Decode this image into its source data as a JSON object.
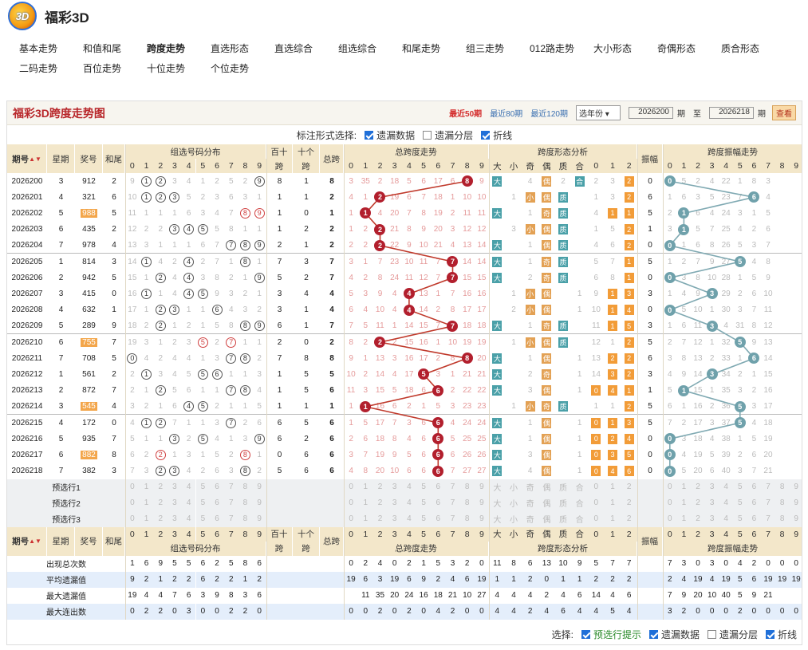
{
  "app": {
    "title": "福彩3D",
    "logo": "3D"
  },
  "nav": [
    [
      "基本走势",
      "和值和尾",
      "跨度走势",
      "直选形态",
      "直选综合",
      "组选综合",
      "和尾走势",
      "组三走势",
      "012路走势",
      "大小形态",
      "奇偶形态",
      "质合形态"
    ],
    [
      "二码走势",
      "百位走势",
      "十位走势",
      "个位走势"
    ]
  ],
  "nav_active": "跨度走势",
  "panel": {
    "title": "福彩3D跨度走势图",
    "quick": [
      "最近50期",
      "最近80期",
      "最近120期"
    ],
    "year_select": "选年份",
    "from": "2026200",
    "to": "2026218",
    "qi": "期",
    "zhi": "至",
    "btn": "查看"
  },
  "marking": {
    "label": "标注形式选择:",
    "opts": [
      "遗漏数据",
      "遗漏分层",
      "折线"
    ],
    "checked": [
      true,
      false,
      true
    ]
  },
  "headers": {
    "qihao": "期号",
    "week": "星期",
    "jianghao": "奖号",
    "hewei": "和尾",
    "zuxuan": "组选号码分布",
    "baishi": "百十",
    "baishi2": "跨",
    "shige": "十个",
    "shige2": "跨",
    "zongkua": "总跨",
    "zkt": "总跨度走势",
    "xt": "跨度形态分析",
    "zhenfu": "振幅",
    "zfzs": "跨度振幅走势",
    "xtcols": [
      "大",
      "小",
      "奇",
      "偶",
      "质",
      "合",
      "0",
      "1",
      "2"
    ]
  },
  "rows": [
    [
      "2026200",
      "3",
      "912",
      "2",
      [
        9,
        1,
        2,
        3,
        4,
        1,
        2,
        5,
        2,
        9
      ],
      [
        1,
        2,
        9
      ],
      "8",
      "1",
      "8",
      [
        3,
        35,
        2,
        18,
        5,
        6,
        17,
        6,
        8,
        9
      ],
      8,
      [
        "大",
        "",
        4,
        "偶",
        2,
        "合",
        2,
        3,
        "2"
      ],
      [
        0,
        2
      ],
      "0",
      [
        0,
        5,
        2,
        4,
        22,
        1,
        8,
        3,
        "",
        ""
      ],
      0
    ],
    [
      "2026201",
      "4",
      "321",
      "6",
      [
        10,
        1,
        2,
        3,
        5,
        2,
        3,
        6,
        3,
        1
      ],
      [
        1,
        2,
        3
      ],
      "1",
      "1",
      "2",
      [
        4,
        1,
        2,
        19,
        6,
        7,
        18,
        1,
        10,
        10
      ],
      2,
      [
        "",
        1,
        "小",
        "偶",
        "质",
        "",
        1,
        3,
        "2"
      ],
      [
        0,
        2
      ],
      "6",
      [
        1,
        6,
        3,
        5,
        23,
        7,
        6,
        4,
        "",
        ""
      ],
      6
    ],
    [
      "2026202",
      "5",
      "988",
      "5",
      [
        11,
        1,
        1,
        1,
        6,
        3,
        4,
        7,
        8,
        9
      ],
      [
        8,
        9
      ],
      "1",
      "0",
      "1",
      [
        1,
        1,
        4,
        20,
        7,
        8,
        19,
        2,
        11,
        11
      ],
      1,
      [
        "大",
        "",
        1,
        "奇",
        "质",
        "",
        4,
        "1",
        "1"
      ],
      [
        1
      ],
      "5",
      [
        2,
        1,
        6,
        4,
        24,
        3,
        1,
        5,
        "",
        ""
      ],
      1
    ],
    [
      "2026203",
      "6",
      "435",
      "2",
      [
        12,
        2,
        2,
        3,
        4,
        5,
        5,
        8,
        1,
        1
      ],
      [
        3,
        4,
        5
      ],
      "1",
      "2",
      "2",
      [
        1,
        2,
        5,
        21,
        8,
        9,
        20,
        3,
        12,
        12
      ],
      2,
      [
        "",
        3,
        "小",
        "偶",
        "质",
        "",
        1,
        5,
        "2"
      ],
      [
        3,
        5
      ],
      "1",
      [
        3,
        1,
        5,
        7,
        25,
        4,
        2,
        6,
        "",
        ""
      ],
      1
    ],
    [
      "2026204",
      "7",
      "978",
      "4",
      [
        13,
        3,
        1,
        1,
        1,
        6,
        7,
        8,
        9,
        2
      ],
      [
        7,
        8,
        9
      ],
      "2",
      "1",
      "2",
      [
        2,
        2,
        6,
        22,
        9,
        10,
        21,
        4,
        13,
        14
      ],
      2,
      [
        "大",
        "",
        1,
        "偶",
        "质",
        "",
        4,
        6,
        "2"
      ],
      [
        3,
        5
      ],
      "0",
      [
        0,
        1,
        6,
        8,
        26,
        5,
        3,
        7,
        "",
        ""
      ],
      0
    ],
    [
      "2026205",
      "1",
      "814",
      "3",
      [
        14,
        1,
        4,
        2,
        4,
        2,
        7,
        1,
        8,
        1
      ],
      [
        1,
        4,
        8
      ],
      "7",
      "3",
      "7",
      [
        3,
        1,
        7,
        23,
        10,
        11,
        7,
        1,
        14,
        14
      ],
      7,
      [
        "大",
        "",
        1,
        "奇",
        "质",
        "",
        5,
        7,
        "1"
      ],
      [
        6
      ],
      "5",
      [
        1,
        2,
        7,
        9,
        27,
        5,
        4,
        8,
        "",
        ""
      ],
      5
    ],
    [
      "2026206",
      "2",
      "942",
      "5",
      [
        15,
        1,
        2,
        4,
        4,
        3,
        8,
        2,
        1,
        9
      ],
      [
        2,
        4,
        9
      ],
      "5",
      "2",
      "7",
      [
        4,
        2,
        8,
        24,
        11,
        12,
        7,
        6,
        15,
        15
      ],
      7,
      [
        "大",
        "",
        2,
        "奇",
        "质",
        "",
        6,
        8,
        "1"
      ],
      [
        6
      ],
      "0",
      [
        0,
        3,
        8,
        10,
        28,
        1,
        5,
        9,
        "",
        ""
      ],
      0
    ],
    [
      "2026207",
      "3",
      "415",
      "0",
      [
        16,
        1,
        1,
        4,
        4,
        5,
        9,
        3,
        2,
        1
      ],
      [
        1,
        4,
        5
      ],
      "3",
      "4",
      "4",
      [
        5,
        3,
        9,
        4,
        12,
        13,
        1,
        7,
        16,
        16
      ],
      4,
      [
        "",
        1,
        "小",
        "偶",
        "",
        1,
        9,
        "1",
        "3"
      ],
      [
        7
      ],
      "3",
      [
        1,
        4,
        9,
        3,
        29,
        2,
        6,
        10,
        "",
        ""
      ],
      3
    ],
    [
      "2026208",
      "4",
      "632",
      "1",
      [
        17,
        1,
        2,
        3,
        1,
        1,
        6,
        4,
        3,
        2
      ],
      [
        2,
        3,
        6
      ],
      "3",
      "1",
      "4",
      [
        6,
        4,
        10,
        4,
        13,
        14,
        2,
        8,
        17,
        17
      ],
      4,
      [
        "",
        2,
        "小",
        "偶",
        "",
        1,
        10,
        "1",
        "4"
      ],
      [
        7
      ],
      "0",
      [
        0,
        5,
        10,
        1,
        30,
        3,
        7,
        11,
        "",
        ""
      ],
      0
    ],
    [
      "2026209",
      "5",
      "289",
      "9",
      [
        18,
        2,
        2,
        1,
        2,
        1,
        5,
        8,
        9,
        1
      ],
      [
        2,
        8,
        9
      ],
      "6",
      "1",
      "7",
      [
        7,
        5,
        11,
        1,
        14,
        15,
        7,
        9,
        18,
        18
      ],
      7,
      [
        "大",
        "",
        1,
        "奇",
        "质",
        "",
        11,
        "1",
        "5"
      ],
      [
        6
      ],
      "3",
      [
        1,
        6,
        11,
        3,
        4,
        31,
        8,
        12,
        "",
        ""
      ],
      3
    ],
    [
      "2026210",
      "6",
      "755",
      "7",
      [
        19,
        3,
        1,
        2,
        3,
        5,
        2,
        7,
        1,
        1
      ],
      [
        5,
        7
      ],
      "2",
      "0",
      "2",
      [
        8,
        2,
        1,
        2,
        15,
        16,
        1,
        10,
        19,
        19
      ],
      2,
      [
        "",
        1,
        "小",
        "偶",
        "质",
        "",
        12,
        1,
        "2"
      ],
      [
        0,
        2
      ],
      "5",
      [
        2,
        7,
        12,
        1,
        32,
        5,
        9,
        13,
        "",
        ""
      ],
      5
    ],
    [
      "2026211",
      "7",
      "708",
      "5",
      [
        0,
        4,
        2,
        4,
        4,
        1,
        3,
        7,
        8,
        2
      ],
      [
        0,
        7,
        8
      ],
      "7",
      "8",
      "8",
      [
        9,
        1,
        13,
        3,
        16,
        17,
        2,
        8,
        20,
        20
      ],
      8,
      [
        "大",
        "",
        1,
        "偶",
        "",
        1,
        13,
        "2",
        "2"
      ],
      [
        2
      ],
      "6",
      [
        3,
        8,
        13,
        2,
        33,
        1,
        6,
        14,
        "",
        ""
      ],
      6
    ],
    [
      "2026212",
      "1",
      "561",
      "2",
      [
        2,
        1,
        3,
        4,
        5,
        5,
        6,
        1,
        1,
        3
      ],
      [
        1,
        5,
        6
      ],
      "1",
      "5",
      "5",
      [
        10,
        2,
        14,
        4,
        17,
        5,
        3,
        1,
        21,
        21
      ],
      5,
      [
        "大",
        "",
        2,
        "奇",
        "",
        1,
        14,
        "3",
        "2"
      ],
      [
        5
      ],
      "3",
      [
        4,
        9,
        14,
        3,
        34,
        2,
        1,
        15,
        "",
        ""
      ],
      3
    ],
    [
      "2026213",
      "2",
      "872",
      "7",
      [
        2,
        1,
        2,
        5,
        6,
        1,
        1,
        7,
        8,
        4
      ],
      [
        2,
        7,
        8
      ],
      "1",
      "5",
      "6",
      [
        11,
        3,
        15,
        5,
        18,
        6,
        4,
        2,
        22,
        22
      ],
      6,
      [
        "大",
        "",
        3,
        "偶",
        "",
        1,
        "0",
        "4",
        "1"
      ],
      [
        6
      ],
      "1",
      [
        5,
        1,
        15,
        1,
        35,
        3,
        2,
        16,
        "",
        ""
      ],
      1
    ],
    [
      "2026214",
      "3",
      "545",
      "4",
      [
        3,
        2,
        1,
        6,
        4,
        5,
        2,
        1,
        1,
        5
      ],
      [
        4,
        5
      ],
      "1",
      "1",
      "1",
      [
        1,
        1,
        16,
        6,
        2,
        1,
        5,
        3,
        23,
        23
      ],
      1,
      [
        "",
        1,
        "小",
        "奇",
        "质",
        "",
        1,
        1,
        "2"
      ],
      [
        1
      ],
      "5",
      [
        6,
        1,
        16,
        2,
        36,
        5,
        3,
        17,
        "",
        ""
      ],
      5
    ],
    [
      "2026215",
      "4",
      "172",
      "0",
      [
        4,
        1,
        2,
        7,
        1,
        1,
        3,
        7,
        2,
        6
      ],
      [
        1,
        2,
        7
      ],
      "6",
      "5",
      "6",
      [
        1,
        5,
        17,
        7,
        3,
        6,
        6,
        4,
        24,
        24
      ],
      6,
      [
        "大",
        "",
        1,
        "偶",
        "",
        1,
        "0",
        "1",
        "3"
      ],
      [
        6
      ],
      "5",
      [
        7,
        2,
        17,
        3,
        37,
        5,
        4,
        18,
        "",
        ""
      ],
      5
    ],
    [
      "2026216",
      "5",
      "935",
      "7",
      [
        5,
        1,
        1,
        3,
        2,
        5,
        4,
        1,
        3,
        9
      ],
      [
        3,
        5,
        9
      ],
      "6",
      "2",
      "6",
      [
        2,
        6,
        18,
        8,
        4,
        6,
        7,
        5,
        25,
        25
      ],
      6,
      [
        "大",
        "",
        1,
        "偶",
        "",
        1,
        "0",
        "2",
        "4"
      ],
      [
        6
      ],
      "0",
      [
        0,
        3,
        18,
        4,
        38,
        1,
        5,
        19,
        "",
        ""
      ],
      0
    ],
    [
      "2026217",
      "6",
      "882",
      "8",
      [
        6,
        2,
        2,
        1,
        3,
        1,
        5,
        2,
        8,
        1
      ],
      [
        2,
        8
      ],
      "0",
      "6",
      "6",
      [
        3,
        7,
        19,
        9,
        5,
        6,
        8,
        6,
        26,
        26
      ],
      6,
      [
        "大",
        "",
        3,
        "偶",
        "",
        1,
        "0",
        "3",
        "5"
      ],
      [
        6
      ],
      "0",
      [
        0,
        4,
        19,
        5,
        39,
        2,
        6,
        20,
        "",
        ""
      ],
      0
    ],
    [
      "2026218",
      "7",
      "382",
      "3",
      [
        7,
        3,
        2,
        3,
        4,
        2,
        6,
        3,
        8,
        2
      ],
      [
        2,
        3,
        8
      ],
      "5",
      "6",
      "6",
      [
        4,
        8,
        20,
        10,
        6,
        6,
        9,
        7,
        27,
        27
      ],
      6,
      [
        "大",
        "",
        4,
        "偶",
        "",
        1,
        "0",
        "4",
        "6"
      ],
      [
        6
      ],
      "0",
      [
        0,
        5,
        20,
        6,
        40,
        3,
        7,
        21,
        "",
        ""
      ],
      0
    ]
  ],
  "rows_hl": [
    2,
    10,
    14,
    17
  ],
  "pred": [
    "预选行1",
    "预选行2",
    "预选行3"
  ],
  "digits": [
    "0",
    "1",
    "2",
    "3",
    "4",
    "5",
    "6",
    "7",
    "8",
    "9"
  ],
  "stats": {
    "labels": [
      "出现总次数",
      "平均遗漏值",
      "最大遗漏值",
      "最大连出数"
    ],
    "zu": [
      [
        "1",
        "6",
        "9",
        "5",
        "5",
        "6",
        "2",
        "5",
        "8",
        "6"
      ],
      [
        "9",
        "2",
        "1",
        "2",
        "2",
        "6",
        "2",
        "2",
        "1",
        "2"
      ],
      [
        "19",
        "4",
        "4",
        "7",
        "6",
        "3",
        "9",
        "8",
        "3",
        "6"
      ],
      [
        "0",
        "2",
        "2",
        "0",
        "3",
        "0",
        "0",
        "2",
        "2",
        "0"
      ]
    ],
    "zk": [
      [
        "0",
        "2",
        "4",
        "0",
        "2",
        "1",
        "5",
        "3",
        "2",
        "0"
      ],
      [
        "19",
        "6",
        "3",
        "19",
        "6",
        "9",
        "2",
        "4",
        "6",
        "19"
      ],
      [
        "",
        "11",
        "35",
        "20",
        "24",
        "16",
        "18",
        "21",
        "10",
        "27"
      ],
      [
        "0",
        "0",
        "2",
        "0",
        "2",
        "0",
        "4",
        "2",
        "0",
        "0"
      ]
    ],
    "xt": [
      [
        "11",
        "8",
        "6",
        "13",
        "10",
        "9",
        "5",
        "7",
        "7"
      ],
      [
        "1",
        "1",
        "2",
        "0",
        "1",
        "1",
        "2",
        "2",
        "2"
      ],
      [
        "4",
        "4",
        "4",
        "2",
        "4",
        "6",
        "14",
        "4",
        "6"
      ],
      [
        "4",
        "4",
        "2",
        "4",
        "6",
        "4",
        "4",
        "5",
        "4"
      ]
    ],
    "zf": [
      [
        "7",
        "3",
        "0",
        "3",
        "0",
        "4",
        "2",
        "0",
        "0",
        "0"
      ],
      [
        "2",
        "4",
        "19",
        "4",
        "19",
        "5",
        "6",
        "19",
        "19",
        "19"
      ],
      [
        "7",
        "9",
        "20",
        "10",
        "40",
        "5",
        "9",
        "21",
        "",
        ""
      ],
      [
        "3",
        "2",
        "0",
        "0",
        "0",
        "2",
        "0",
        "0",
        "0",
        "0"
      ]
    ]
  },
  "footer": {
    "label": "选择:",
    "opts": [
      "预选行提示",
      "遗漏数据",
      "遗漏分层",
      "折线"
    ],
    "checked": [
      true,
      true,
      false,
      true
    ]
  },
  "colors": {
    "accent": "#b8262a",
    "ball": "#b21f2d",
    "zf_ball": "#6fa1ab",
    "line_red": "#c0392b",
    "line_teal": "#7fa9b2"
  }
}
